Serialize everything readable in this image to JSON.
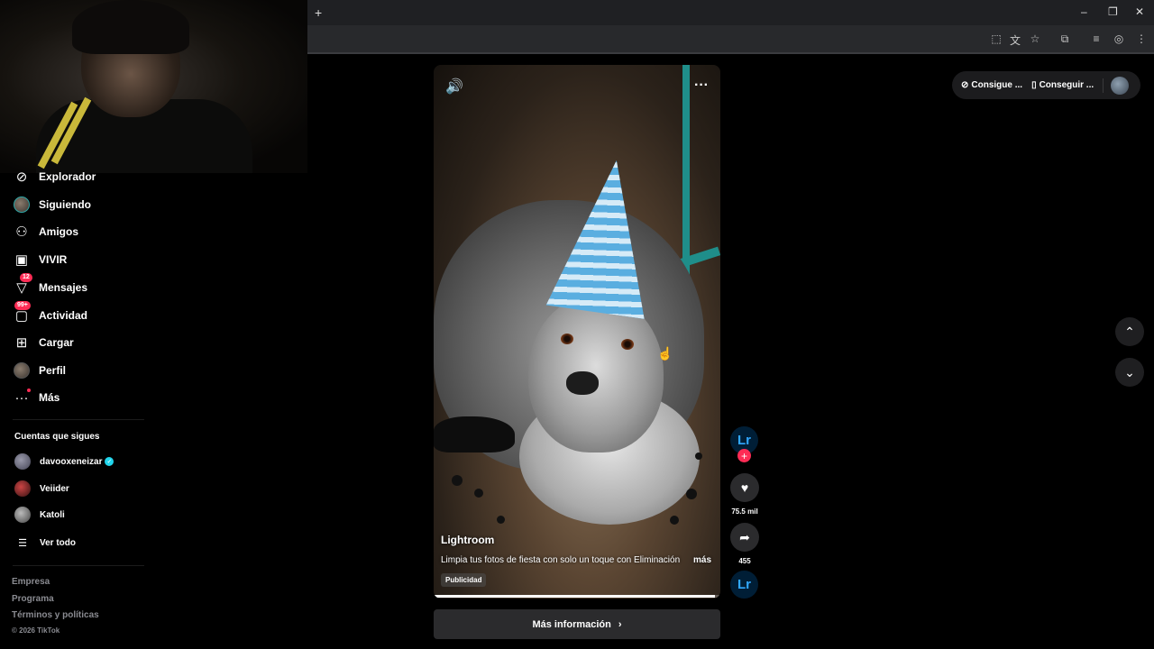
{
  "browser": {
    "new_tab_glyph": "+",
    "window_controls": [
      "–",
      "❐",
      "✕"
    ],
    "toolbar_icons": [
      "install-icon",
      "translate-icon",
      "star-icon",
      "extensions-icon",
      "media-icon",
      "profile-icon",
      "menu-icon"
    ]
  },
  "sidebar": {
    "items": [
      {
        "label": "Explorador",
        "icon": "compass-icon"
      },
      {
        "label": "Siguiendo",
        "icon": "avatar"
      },
      {
        "label": "Amigos",
        "icon": "friends-icon"
      },
      {
        "label": "VIVIR",
        "icon": "live-icon"
      },
      {
        "label": "Mensajes",
        "icon": "messages-icon",
        "badge": "12"
      },
      {
        "label": "Actividad",
        "icon": "activity-icon",
        "badge": "99+"
      },
      {
        "label": "Cargar",
        "icon": "upload-icon"
      },
      {
        "label": "Perfil",
        "icon": "avatar"
      },
      {
        "label": "Más",
        "icon": "more-icon"
      }
    ],
    "following_title": "Cuentas que sigues",
    "following": [
      {
        "name": "davooxeneizar",
        "verified": true
      },
      {
        "name": "Veiider",
        "verified": false
      },
      {
        "name": "Katoli",
        "verified": false
      }
    ],
    "see_all": "Ver todo",
    "footer": [
      "Empresa",
      "Programa",
      "Términos y políticas"
    ],
    "copyright": "© 2026 TikTok"
  },
  "video": {
    "author": "Lightroom",
    "caption": "Limpia tus fotos de fiesta con solo un toque con Eliminación",
    "more": "más",
    "ad_label": "Publicidad",
    "progress": 0.98,
    "cta": "Más información"
  },
  "actions": {
    "brand_short": "Lr",
    "likes": "75.5 mil",
    "shares": "455"
  },
  "top_right": {
    "coins": "Consigue ...",
    "app": "Conseguir ..."
  }
}
